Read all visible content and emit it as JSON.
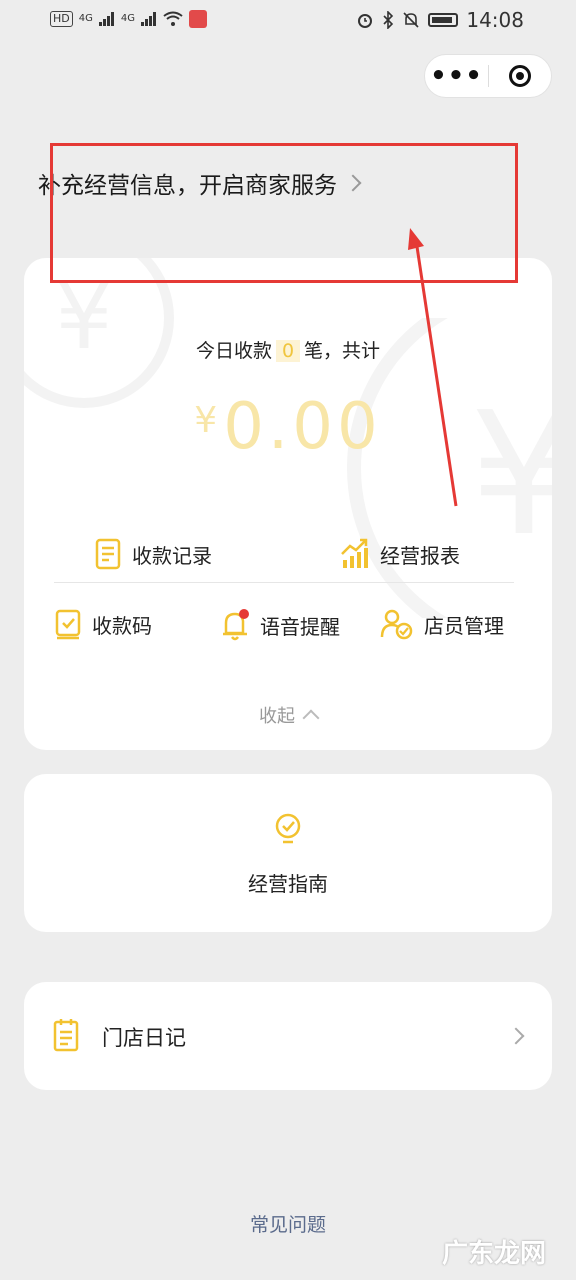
{
  "status_bar": {
    "hd_label": "HD",
    "net_a": "4G",
    "net_b": "4G",
    "time": "14:08"
  },
  "capsule": {
    "more_label": "•••"
  },
  "supplement_link": {
    "label": "补充经营信息，开启商家服务"
  },
  "summary": {
    "prefix": "今日收款",
    "count": "0",
    "suffix": "笔，共计",
    "currency": "¥",
    "amount": "0.00"
  },
  "features_row1": [
    {
      "label": "收款记录",
      "icon": "document-icon"
    },
    {
      "label": "经营报表",
      "icon": "chart-trend-icon"
    }
  ],
  "features_row2": [
    {
      "label": "收款码",
      "icon": "qr-book-icon"
    },
    {
      "label": "语音提醒",
      "icon": "bell-icon"
    },
    {
      "label": "店员管理",
      "icon": "staff-icon"
    }
  ],
  "collapse_label": "收起",
  "guide": {
    "label": "经营指南",
    "icon": "lightbulb-icon"
  },
  "diary": {
    "label": "门店日记",
    "icon": "notepad-icon"
  },
  "faq_label": "常见问题",
  "watermark_logo": "广东龙网",
  "colors": {
    "accent_yellow": "#f2c230",
    "annotation_red": "#e53935",
    "link_blue": "#5b6b8c"
  }
}
